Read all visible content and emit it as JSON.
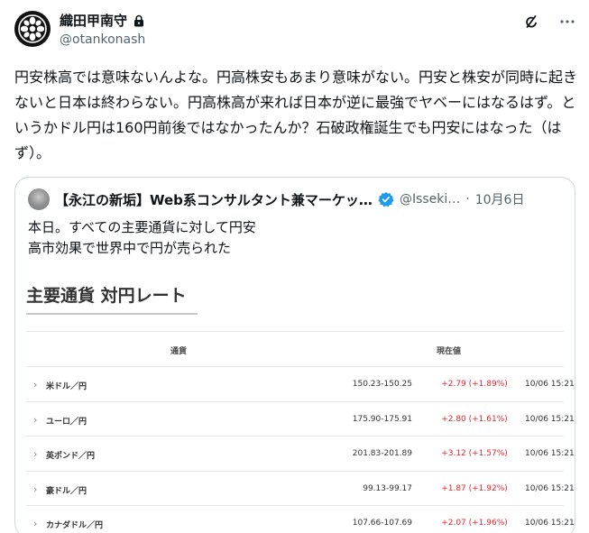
{
  "author": {
    "display_name": "織田甲南守",
    "handle": "@otankonash"
  },
  "tweet": {
    "text": "円安株高では意味ないんよな。円高株安もあまり意味がない。円安と株安が同時に起きないと日本は終わらない。円高株高が来れば日本が逆に最強でヤベーにはなるはず。というかドル円は160円前後ではなかったんか？石破政権誕生でも円安にはなった（はず）。"
  },
  "quote": {
    "author_name": "【永江の新垢】Web系コンサルタント兼マーケッ…",
    "handle": "@Isseki…",
    "dot": "·",
    "date": "10月6日",
    "text_line1": "本日。すべての主要通貨に対して円安",
    "text_line2": "高市効果で世界中で円が売られた"
  },
  "rate_card": {
    "title": "主要通貨 対円レート",
    "col_currency": "通貨",
    "col_value": "現在値",
    "rows": [
      {
        "name": "米ドル／円",
        "rate": "150.23-150.25",
        "change": "+2.79 (+1.89%)",
        "time": "10/06 15:21"
      },
      {
        "name": "ユーロ／円",
        "rate": "175.90-175.91",
        "change": "+2.80 (+1.61%)",
        "time": "10/06 15:21"
      },
      {
        "name": "英ポンド／円",
        "rate": "201.83-201.89",
        "change": "+3.12 (+1.57%)",
        "time": "10/06 15:21"
      },
      {
        "name": "豪ドル／円",
        "rate": "99.13-99.17",
        "change": "+1.87 (+1.92%)",
        "time": "10/06 15:21"
      },
      {
        "name": "カナダドル／円",
        "rate": "107.66-107.69",
        "change": "+2.07 (+1.96%)",
        "time": "10/06 15:21"
      }
    ]
  },
  "icons": {
    "avatar": "family-crest-icon",
    "lock": "lock-icon",
    "grok": "grok-icon",
    "more": "more-icon",
    "verified": "verified-badge-icon",
    "chevron": "chevron-right-icon"
  },
  "colors": {
    "positive_change": "#e0262c",
    "verified": "#1d9bf0",
    "muted_text": "#536471"
  }
}
